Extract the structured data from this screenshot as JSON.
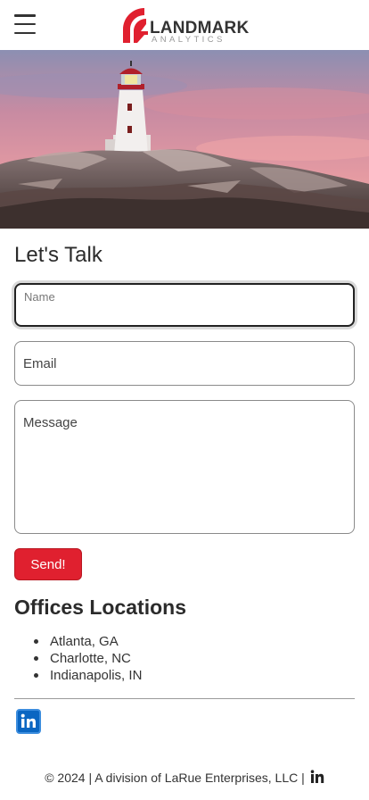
{
  "header": {
    "logo_text": "LANDMARK",
    "logo_sub": "ANALYTICS",
    "menu_icon": "hamburger-menu-icon"
  },
  "colors": {
    "accent": "#e0202f",
    "linkedin": "#0a66c2",
    "text": "#2b2b2b"
  },
  "contact": {
    "title": "Let's Talk",
    "name_label": "Name",
    "email_label": "Email",
    "message_label": "Message",
    "send_label": "Send!"
  },
  "offices": {
    "title": "Offices Locations",
    "items": [
      "Atlanta, GA",
      "Charlotte, NC",
      "Indianapolis, IN"
    ]
  },
  "footer": {
    "text": "© 2024 | A division of LaRue Enterprises, LLC |"
  }
}
